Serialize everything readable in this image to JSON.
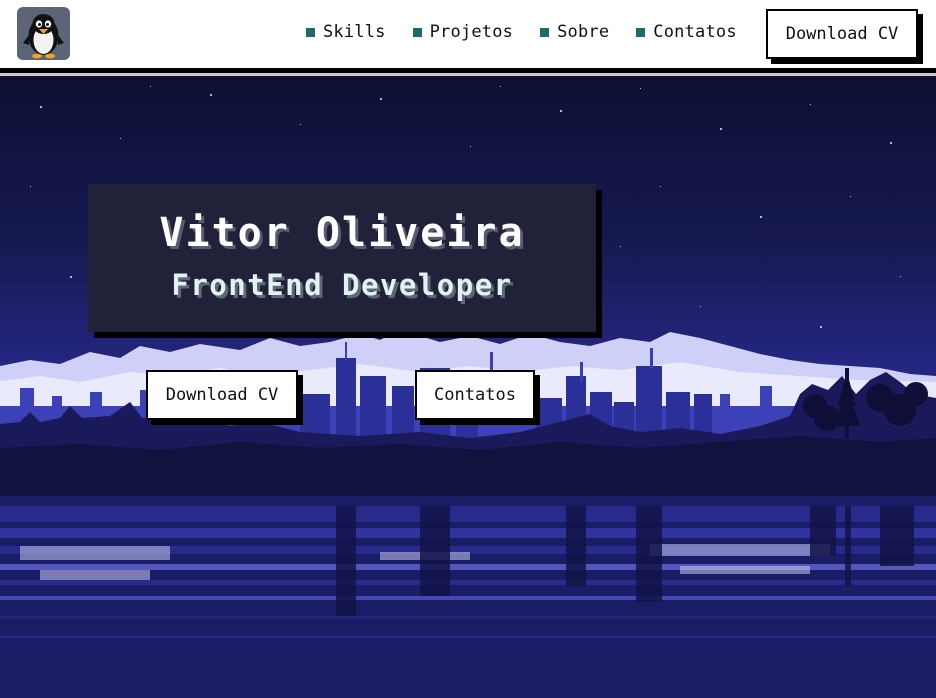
{
  "header": {
    "logo": {
      "icon": "penguin-icon"
    },
    "nav": [
      {
        "label": "Skills"
      },
      {
        "label": "Projetos"
      },
      {
        "label": "Sobre"
      },
      {
        "label": "Contatos"
      }
    ],
    "download_label": "Download CV"
  },
  "hero": {
    "name": "Vitor Oliveira",
    "role": "FrontEnd Developer",
    "download_label": "Download CV",
    "contact_label": "Contatos"
  },
  "colors": {
    "accent": "#1f6b6b",
    "card_bg": "#21213a",
    "sky_top": "#0d0f33",
    "sky_horizon": "#4a4fd0"
  }
}
